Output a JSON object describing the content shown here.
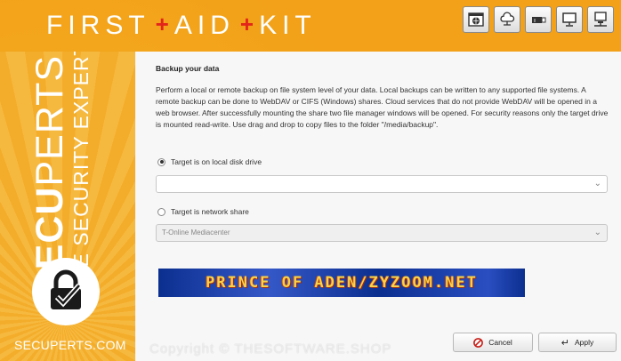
{
  "header": {
    "title_parts": [
      "FIRST",
      "AID",
      "KIT"
    ],
    "plus": "+",
    "icons": [
      "globe-window-icon",
      "cloud-network-icon",
      "usb-drive-icon",
      "monitor-icon",
      "computer-network-icon"
    ]
  },
  "sidebar": {
    "brand_prefix": "SECU",
    "brand_suffix": "PERTS",
    "tagline": "THE SECURITY EXPERTS",
    "url": "SECUPERTS.COM"
  },
  "main": {
    "heading": "Backup your data",
    "description": "Perform a local or remote backup on file system level of your data. Local backups can be written to any supported file systems. A remote backup can be done to WebDAV or CIFS (Windows) shares. Cloud services that do not provide WebDAV will be opened in a web browser. After successfully mounting the share two file manager windows will be opened. For security reasons only the target drive is mounted read-write. Use drag and drop to copy files to the folder \"/media/backup\".",
    "options": [
      {
        "label": "Target is on local disk drive",
        "selected": true
      },
      {
        "label": "Target is network share",
        "selected": false
      }
    ],
    "local_select_value": "",
    "network_select_value": "T-Online Mediacenter",
    "banner_text": "PRINCE OF ADEN/ZYZOOM.NET"
  },
  "footer": {
    "cancel_label": "Cancel",
    "apply_label": "Apply",
    "watermark": "Copyright © THESOFTWARE.SHOP"
  },
  "colors": {
    "accent": "#f4a81e",
    "plus_red": "#e3261a"
  }
}
